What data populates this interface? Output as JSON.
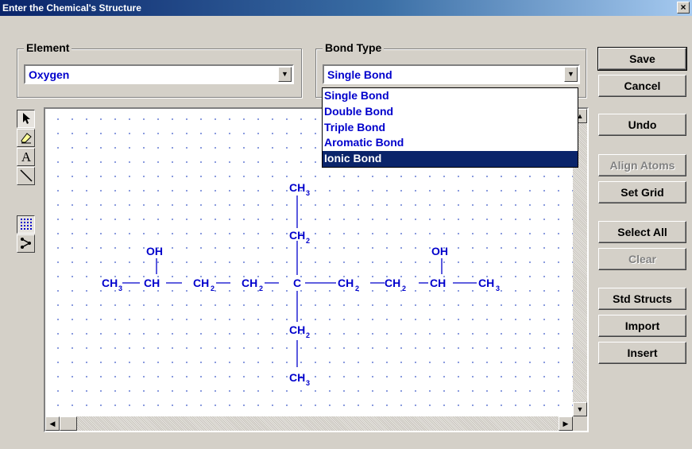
{
  "window": {
    "title": "Enter the Chemical's Structure",
    "close": "×"
  },
  "element_group": {
    "legend": "Element",
    "value": "Oxygen"
  },
  "bond_group": {
    "legend": "Bond Type",
    "value": "Single Bond",
    "options": [
      "Single Bond",
      "Double Bond",
      "Triple Bond",
      "Aromatic Bond",
      "Ionic Bond"
    ],
    "highlighted": "Ionic Bond"
  },
  "buttons": {
    "save": "Save",
    "cancel": "Cancel",
    "undo": "Undo",
    "align_atoms": "Align Atoms",
    "set_grid": "Set Grid",
    "select_all": "Select All",
    "clear": "Clear",
    "std_structs": "Std Structs",
    "import": "Import",
    "insert": "Insert"
  },
  "tools": [
    "pointer-icon",
    "eraser-icon",
    "text-icon",
    "line-icon",
    "grid-icon",
    "bond-tool-icon"
  ],
  "molecule": {
    "chain": [
      "CH",
      "CH",
      "CH",
      "CH",
      "C",
      "CH",
      "CH",
      "CH",
      "CH"
    ],
    "chain_subs": [
      "3",
      "",
      "2",
      "2",
      "",
      "2",
      "2",
      "",
      "3"
    ],
    "oh": "OH",
    "branch_ch2": "CH",
    "branch_ch3": "CH",
    "sub2": "2",
    "sub3": "3"
  },
  "colors": {
    "accent": "#0000cc",
    "title_bar": "#0a246a",
    "highlight": "#0a246a"
  }
}
